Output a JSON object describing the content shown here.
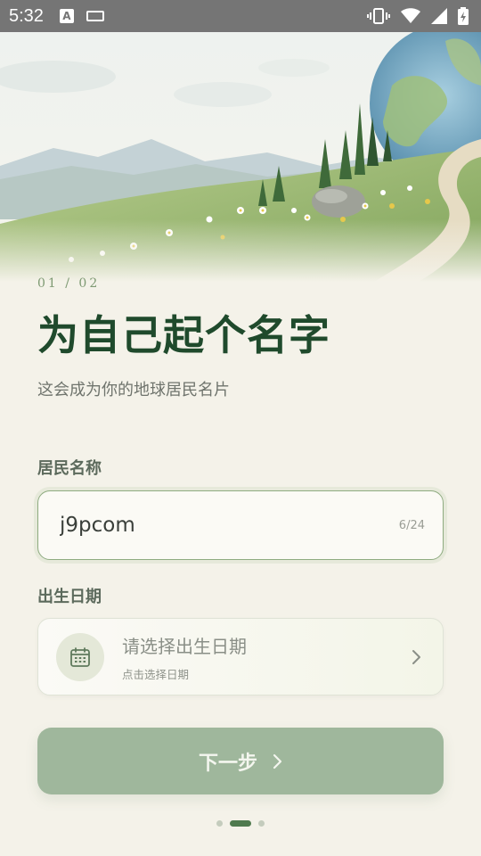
{
  "status_bar": {
    "time": "5:32",
    "left_icons": [
      "a-box-icon",
      "keyboard-icon"
    ],
    "right_icons": [
      "vibrate-icon",
      "wifi-icon",
      "cell-signal-icon",
      "battery-charging-icon"
    ]
  },
  "hero": {
    "image": "watercolor-landscape-with-earth-globe"
  },
  "onboarding": {
    "step": "01 / 02",
    "title": "为自己起个名字",
    "subtitle": "这会成为你的地球居民名片"
  },
  "name_field": {
    "label": "居民名称",
    "value": "j9pcom",
    "counter": "6/24"
  },
  "birth_field": {
    "label": "出生日期",
    "placeholder": "请选择出生日期",
    "hint": "点击选择日期",
    "icon": "calendar-icon"
  },
  "next_button": {
    "label": "下一步",
    "icon": "chevron-right-icon"
  },
  "pager": {
    "total": 3,
    "active_index": 1
  },
  "colors": {
    "background": "#f4f2e9",
    "title": "#1f4a2c",
    "accent": "#4f7a4e",
    "button": "#9fb79c"
  }
}
